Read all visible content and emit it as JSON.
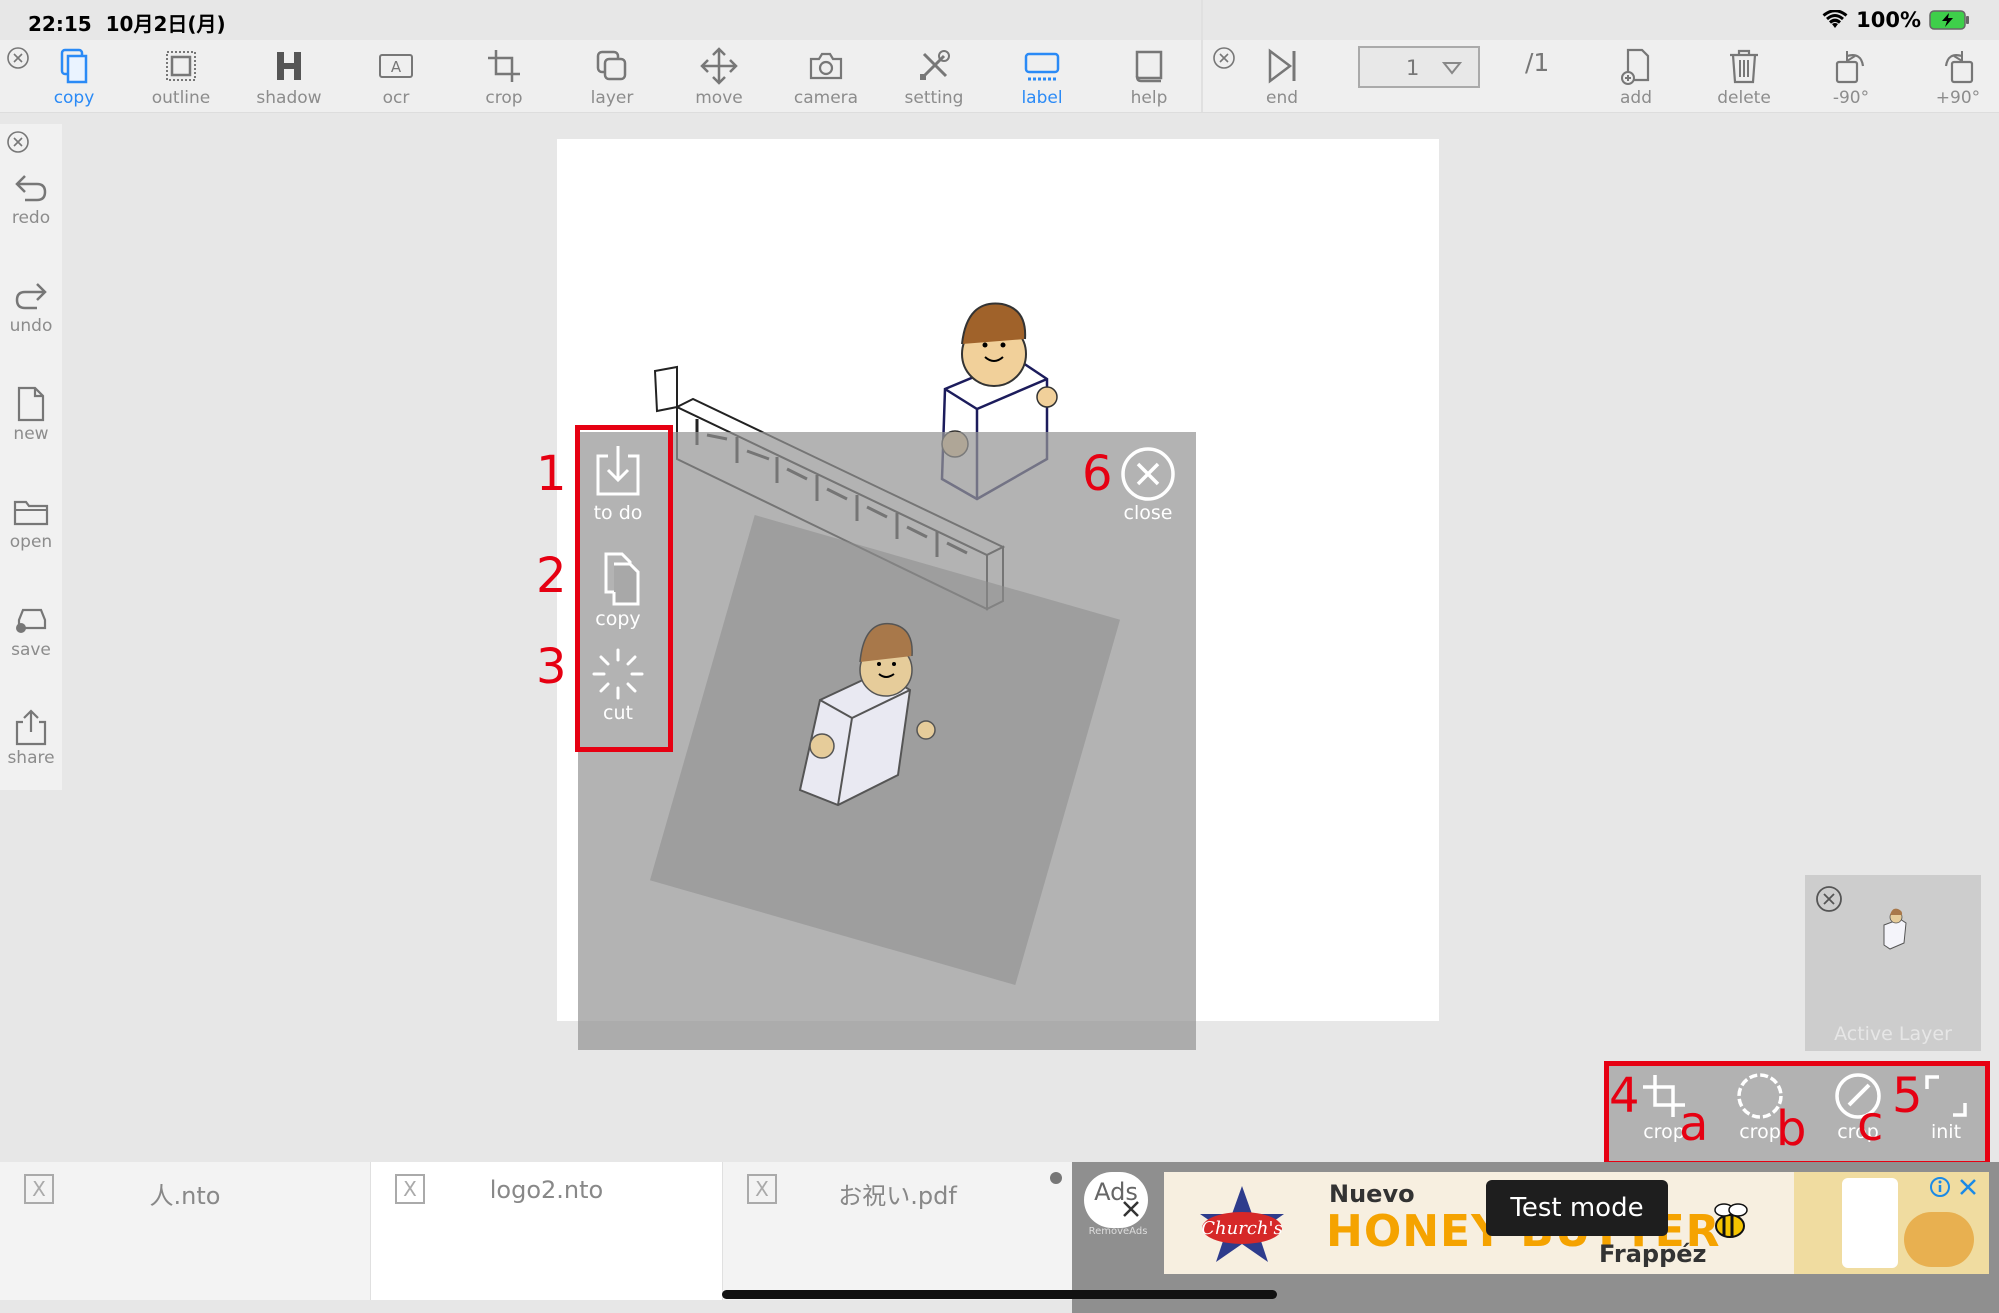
{
  "status": {
    "time": "22:15",
    "date": "10月2日(月)",
    "battery": "100%"
  },
  "toolbar": {
    "items": [
      {
        "label": "copy"
      },
      {
        "label": "outline"
      },
      {
        "label": "shadow"
      },
      {
        "label": "ocr"
      },
      {
        "label": "crop"
      },
      {
        "label": "layer"
      },
      {
        "label": "move"
      },
      {
        "label": "camera"
      },
      {
        "label": "setting"
      },
      {
        "label": "label"
      },
      {
        "label": "help"
      }
    ],
    "end_label": "end",
    "page_value": "1",
    "page_total": "/1",
    "add_label": "add",
    "delete_label": "delete",
    "rotate_left_label": "-90°",
    "rotate_right_label": "+90°"
  },
  "sidebar": {
    "items": [
      {
        "label": "redo"
      },
      {
        "label": "undo"
      },
      {
        "label": "new"
      },
      {
        "label": "open"
      },
      {
        "label": "save"
      },
      {
        "label": "share"
      }
    ]
  },
  "context_menu": {
    "todo_label": "to do",
    "copy_label": "copy",
    "cut_label": "cut",
    "close_label": "close"
  },
  "annotations": {
    "n1": "1",
    "n2": "2",
    "n3": "3",
    "n4": "4",
    "n5": "5",
    "n6": "6",
    "a": "a",
    "b": "b",
    "c": "c"
  },
  "active_layer": {
    "label": "Active Layer"
  },
  "crop_panel": {
    "items": [
      {
        "label": "crop"
      },
      {
        "label": "crop"
      },
      {
        "label": "crop"
      },
      {
        "label": "init"
      }
    ]
  },
  "tabs": [
    {
      "name": "人.nto"
    },
    {
      "name": "logo2.nto"
    },
    {
      "name": "お祝い.pdf"
    }
  ],
  "ads": {
    "ads_label": "Ads",
    "remove_label": "RemoveAds",
    "brand": "Church's",
    "headline_top": "Nuevo",
    "headline_main": "HONEY BUTTER",
    "headline_bottom": "Frappéz",
    "test_mode": "Test mode"
  },
  "colors": {
    "accent": "#2a8af6",
    "annotation_red": "#e60012",
    "overlay_gray": "#969696"
  }
}
